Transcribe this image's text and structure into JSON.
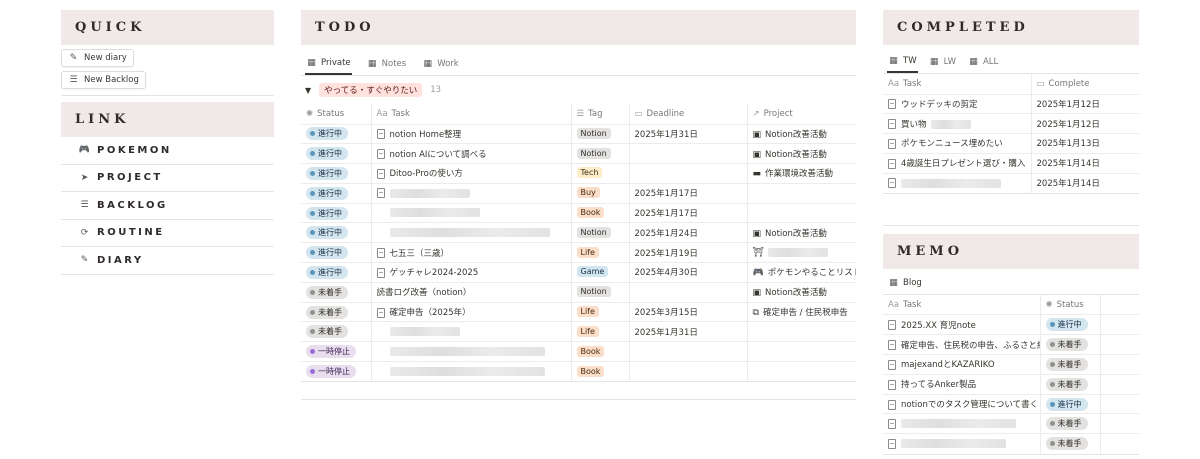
{
  "quick": {
    "title": "QUICK",
    "new_diary": "New diary",
    "new_backlog": "New Backlog"
  },
  "link": {
    "title": "LINK",
    "items": [
      {
        "label": "POKEMON",
        "icon": "gamepad-icon"
      },
      {
        "label": "PROJECT",
        "icon": "send-icon"
      },
      {
        "label": "BACKLOG",
        "icon": "list-icon"
      },
      {
        "label": "ROUTINE",
        "icon": "repeat-icon"
      },
      {
        "label": "DIARY",
        "icon": "pencil-icon"
      }
    ]
  },
  "todo": {
    "title": "TODO",
    "tabs": [
      "Private",
      "Notes",
      "Work"
    ],
    "group_label": "やってる・すぐやりたい",
    "group_count": "13",
    "columns": [
      "Status",
      "Task",
      "Tag",
      "Deadline",
      "Project"
    ],
    "rows": [
      {
        "status": "進行中",
        "task": "notion Home整理",
        "tag": "Notion",
        "deadline": "2025年1月31日",
        "project": "Notion改善活動"
      },
      {
        "status": "進行中",
        "task": "notion AIについて調べる",
        "tag": "Notion",
        "deadline": "",
        "project": "Notion改善活動"
      },
      {
        "status": "進行中",
        "task": "Ditoo-Proの使い方",
        "tag": "Tech",
        "deadline": "",
        "project": "作業環境改善活動"
      },
      {
        "status": "進行中",
        "task": "",
        "tag": "Buy",
        "deadline": "2025年1月17日",
        "project": ""
      },
      {
        "status": "進行中",
        "task": "",
        "tag": "Book",
        "deadline": "2025年1月17日",
        "project": ""
      },
      {
        "status": "進行中",
        "task": "",
        "tag": "Notion",
        "deadline": "2025年1月24日",
        "project": "Notion改善活動"
      },
      {
        "status": "進行中",
        "task": "七五三（三歳）",
        "tag": "Life",
        "deadline": "2025年1月19日",
        "project": ""
      },
      {
        "status": "進行中",
        "task": "ゲッチャレ2024-2025",
        "tag": "Game",
        "deadline": "2025年4月30日",
        "project": "ポケモンやることリスト"
      },
      {
        "status": "未着手",
        "task": "読書ログ改善（notion）",
        "tag": "Notion",
        "deadline": "",
        "project": "Notion改善活動"
      },
      {
        "status": "未着手",
        "task": "確定申告（2025年）",
        "tag": "Life",
        "deadline": "2025年3月15日",
        "project": "確定申告 / 住民税申告"
      },
      {
        "status": "未着手",
        "task": "",
        "tag": "Life",
        "deadline": "2025年1月31日",
        "project": ""
      },
      {
        "status": "一時停止",
        "task": "",
        "tag": "Book",
        "deadline": "",
        "project": ""
      },
      {
        "status": "一時停止",
        "task": "",
        "tag": "Book",
        "deadline": "",
        "project": ""
      }
    ]
  },
  "completed": {
    "title": "COMPLETED",
    "tabs": [
      "TW",
      "LW",
      "ALL"
    ],
    "columns": [
      "Task",
      "Complete"
    ],
    "rows": [
      {
        "task": "ウッドデッキの剪定",
        "complete": "2025年1月12日"
      },
      {
        "task": "買い物",
        "complete": "2025年1月12日"
      },
      {
        "task": "ポケモンニュース埋めたい",
        "complete": "2025年1月13日"
      },
      {
        "task": "4歳誕生日プレゼント選び・購入",
        "complete": "2025年1月14日"
      },
      {
        "task": "",
        "complete": "2025年1月14日"
      }
    ]
  },
  "memo": {
    "title": "MEMO",
    "tab": "Blog",
    "columns": [
      "Task",
      "Status"
    ],
    "rows": [
      {
        "task": "2025.XX 育児note",
        "status": "進行中"
      },
      {
        "task": "確定申告、住民税の申告、ふるさと納",
        "status": "未着手"
      },
      {
        "task": "majexandとKAZARIKO",
        "status": "未着手"
      },
      {
        "task": "持ってるAnker製品",
        "status": "未着手"
      },
      {
        "task": "notionでのタスク管理について書く",
        "status": "進行中"
      },
      {
        "task": "",
        "status": "未着手"
      },
      {
        "task": "",
        "status": "未着手"
      }
    ]
  },
  "colors": {
    "header_bg": "#f1e8e8",
    "status_in_progress": "#d3e5ef",
    "status_not_started": "#e3e2e0",
    "status_paused": "#e8deee",
    "group_tag": "#ffe2dd"
  }
}
